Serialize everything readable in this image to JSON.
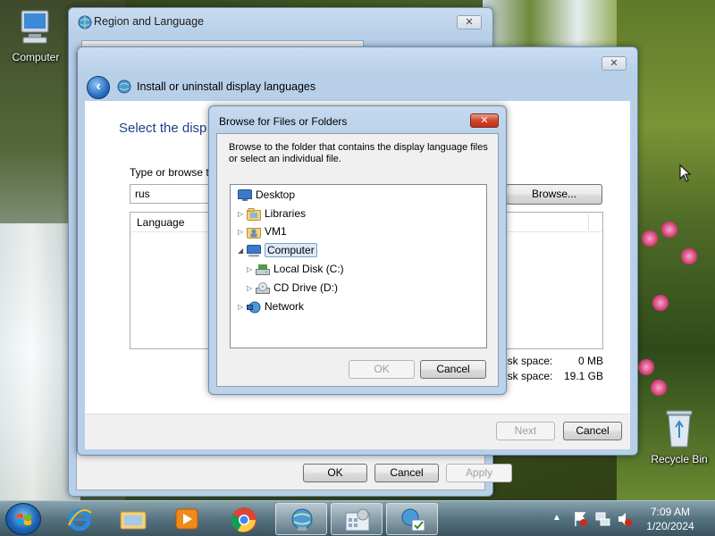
{
  "desktop": {
    "icons": [
      {
        "label": "Computer",
        "icon": "computer-icon"
      },
      {
        "label": "Recycle Bin",
        "icon": "recycle-bin-icon"
      }
    ]
  },
  "region_window": {
    "title": "Region and Language",
    "buttons": {
      "ok": "OK",
      "cancel": "Cancel",
      "apply": "Apply"
    }
  },
  "install_window": {
    "title": "Install or uninstall display languages",
    "heading": "Select the disp",
    "type_label": "Type or browse t",
    "path_value": "rus",
    "browse_button": "Browse...",
    "list_header": "Language",
    "disk_space_required_label": "isk space:",
    "disk_space_required_value": "0 MB",
    "disk_space_available_label": "isk space:",
    "disk_space_available_value": "19.1 GB",
    "next_button": "Next",
    "cancel_button": "Cancel"
  },
  "browse_dialog": {
    "title": "Browse for Files or Folders",
    "instructions": "Browse to the folder that contains the display language files or select an individual file.",
    "tree": [
      {
        "label": "Desktop",
        "icon": "desktop-icon",
        "expander": ""
      },
      {
        "label": "Libraries",
        "icon": "libraries-icon",
        "expander": "collapsed"
      },
      {
        "label": "VM1",
        "icon": "user-folder-icon",
        "expander": "collapsed"
      },
      {
        "label": "Computer",
        "icon": "computer-icon",
        "expander": "expanded",
        "selected": true
      },
      {
        "label": "Local Disk (C:)",
        "icon": "local-disk-icon",
        "expander": "collapsed"
      },
      {
        "label": "CD Drive (D:)",
        "icon": "cd-drive-icon",
        "expander": "collapsed"
      },
      {
        "label": "Network",
        "icon": "network-icon",
        "expander": "collapsed"
      }
    ],
    "ok_button": "OK",
    "cancel_button": "Cancel",
    "close_symbol": "✕"
  },
  "taskbar": {
    "pinned": [
      "internet-explorer-icon",
      "windows-explorer-icon",
      "media-player-icon",
      "chrome-icon",
      "region-language-icon",
      "control-panel-icon",
      "install-language-icon"
    ],
    "clock_time": "7:09 AM",
    "clock_date": "1/20/2024",
    "tray_arrow": "▲"
  },
  "colors": {
    "accent": "#2a6fc4",
    "close_red": "#c0301a"
  }
}
